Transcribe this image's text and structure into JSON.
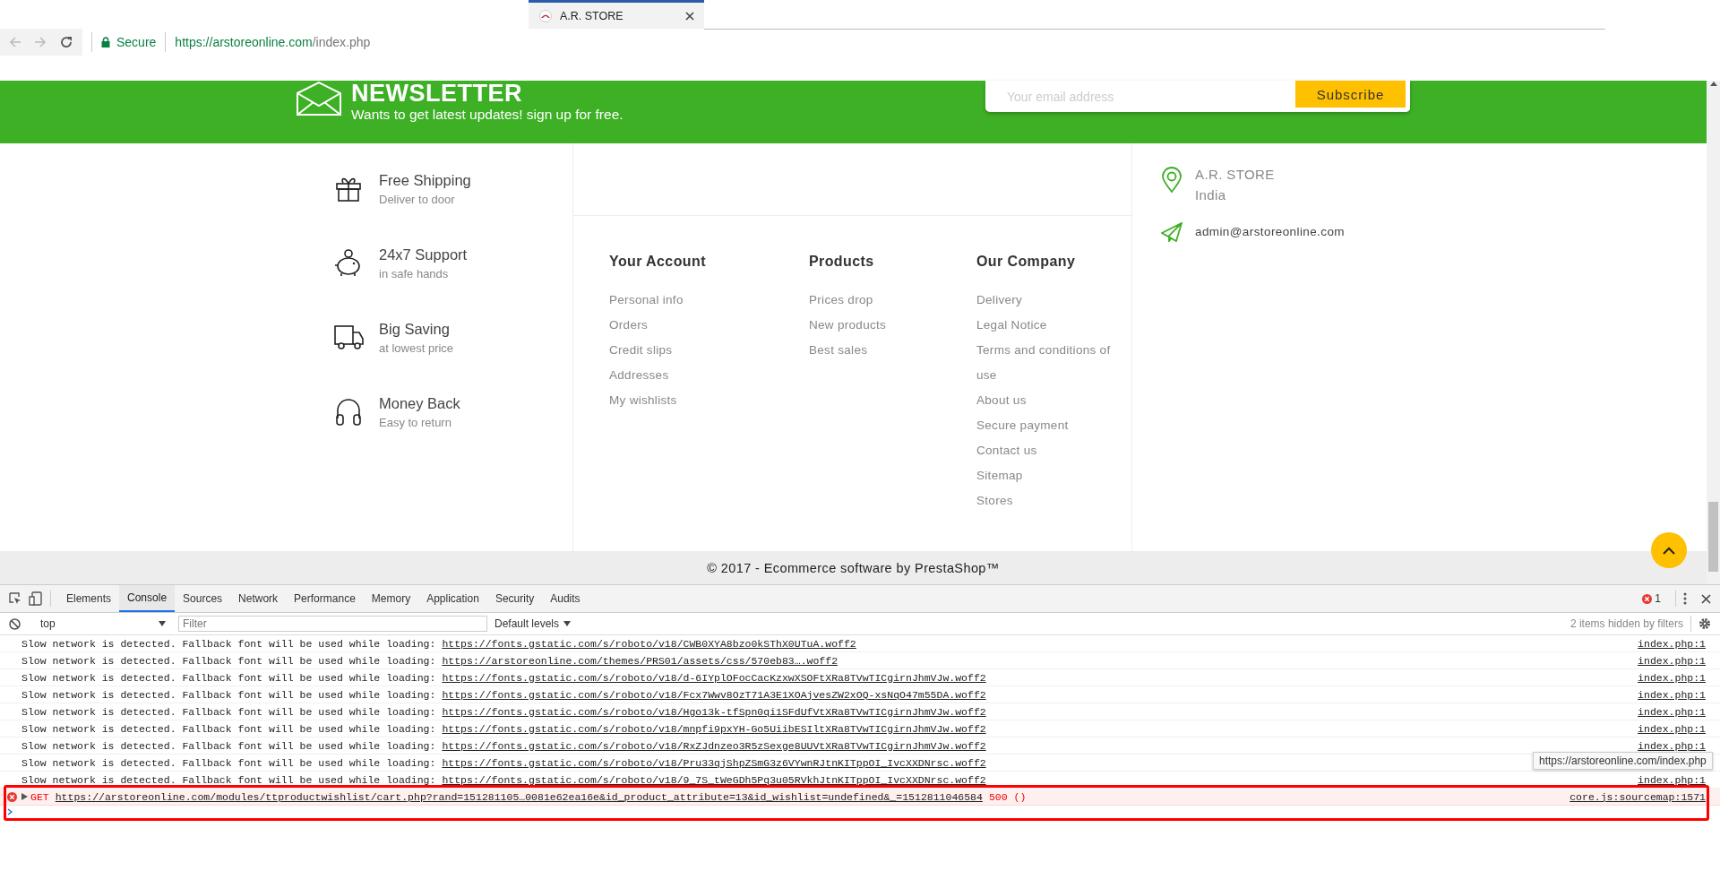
{
  "browser": {
    "tab": {
      "title": "A.R. STORE"
    },
    "security": "Secure",
    "url_host": "https://arstoreonline.com",
    "url_path": "/index.php"
  },
  "newsletter": {
    "title": "NEWSLETTER",
    "subtitle": "Wants to get latest updates! sign up for free.",
    "email": {
      "placeholder": "Your email address"
    },
    "button": "Subscribe"
  },
  "features": [
    {
      "kind": "gift",
      "title": "Free Shipping",
      "subtitle": "Deliver to door"
    },
    {
      "kind": "piggy",
      "title": "24x7 Support",
      "subtitle": "in safe hands"
    },
    {
      "kind": "truck",
      "title": "Big Saving",
      "subtitle": "at lowest price"
    },
    {
      "kind": "headphones",
      "title": "Money Back",
      "subtitle": "Easy to return"
    }
  ],
  "link_columns": [
    {
      "heading": "Your Account",
      "links": [
        "Personal info",
        "Orders",
        "Credit slips",
        "Addresses",
        "My wishlists"
      ]
    },
    {
      "heading": "Products",
      "links": [
        "Prices drop",
        "New products",
        "Best sales"
      ]
    },
    {
      "heading": "Our Company",
      "links": [
        "Delivery",
        "Legal Notice",
        "Terms and conditions of use",
        "About us",
        "Secure payment",
        "Contact us",
        "Sitemap",
        "Stores"
      ]
    }
  ],
  "store_info": {
    "name": "A.R. STORE",
    "country": "India",
    "email": "admin@arstoreonline.com"
  },
  "copyright": "© 2017 - Ecommerce software by PrestaShop™",
  "devtools": {
    "tabs": [
      {
        "label": "Elements",
        "selected": false
      },
      {
        "label": "Console",
        "selected": true
      },
      {
        "label": "Sources",
        "selected": false
      },
      {
        "label": "Network",
        "selected": false
      },
      {
        "label": "Performance",
        "selected": false
      },
      {
        "label": "Memory",
        "selected": false
      },
      {
        "label": "Application",
        "selected": false
      },
      {
        "label": "Security",
        "selected": false
      },
      {
        "label": "Audits",
        "selected": false
      }
    ],
    "error_count": "1",
    "context": "top",
    "filter": {
      "placeholder": "Filter"
    },
    "levels": "Default levels",
    "hidden_note": "2 items hidden by filters",
    "messages": [
      {
        "kind": "warning",
        "text": "Slow network is detected. Fallback font will be used while loading:",
        "url": "https://fonts.gstatic.com/s/roboto/v18/CWB0XYA8bzo0kSThX0UTuA.woff2",
        "source": "index.php:1"
      },
      {
        "kind": "warning",
        "text": "Slow network is detected. Fallback font will be used while loading:",
        "url": "https://arstoreonline.com/themes/PRS01/assets/css/570eb83….woff2",
        "source": "index.php:1"
      },
      {
        "kind": "warning",
        "text": "Slow network is detected. Fallback font will be used while loading:",
        "url": "https://fonts.gstatic.com/s/roboto/v18/d-6IYplOFocCacKzxwXSOFtXRa8TVwTICgirnJhmVJw.woff2",
        "source": "index.php:1"
      },
      {
        "kind": "warning",
        "text": "Slow network is detected. Fallback font will be used while loading:",
        "url": "https://fonts.gstatic.com/s/roboto/v18/Fcx7Wwv8OzT71A3E1XOAjvesZW2xOQ-xsNqO47m55DA.woff2",
        "source": "index.php:1"
      },
      {
        "kind": "warning",
        "text": "Slow network is detected. Fallback font will be used while loading:",
        "url": "https://fonts.gstatic.com/s/roboto/v18/Hgo13k-tfSpn0qi1SFdUfVtXRa8TVwTICgirnJhmVJw.woff2",
        "source": "index.php:1"
      },
      {
        "kind": "warning",
        "text": "Slow network is detected. Fallback font will be used while loading:",
        "url": "https://fonts.gstatic.com/s/roboto/v18/mnpfi9pxYH-Go5UiibESIltXRa8TVwTICgirnJhmVJw.woff2",
        "source": "index.php:1"
      },
      {
        "kind": "warning",
        "text": "Slow network is detected. Fallback font will be used while loading:",
        "url": "https://fonts.gstatic.com/s/roboto/v18/RxZJdnzeo3R5zSexge8UUVtXRa8TVwTICgirnJhmVJw.woff2",
        "source": "index.php:1"
      },
      {
        "kind": "warning",
        "text": "Slow network is detected. Fallback font will be used while loading:",
        "url": "https://fonts.gstatic.com/s/roboto/v18/Pru33qjShpZSmG3z6VYwnRJtnKITppOI_IvcXXDNrsc.woff2"
      },
      {
        "kind": "warning",
        "text": "Slow network is detected. Fallback font will be used while loading:",
        "url": "https://fonts.gstatic.com/s/roboto/v18/9_7S_tWeGDh5Pq3u05RVkhJtnKITppOI_IvcXXDNrsc.woff2",
        "source": "index.php:1"
      },
      {
        "kind": "error",
        "method": "GET",
        "url": "https://arstoreonline.com/modules/ttproductwishlist/cart.php?rand=151281105…0081e62ea16e&id_product_attribute=13&id_wishlist=undefined&_=1512811046584",
        "status": "500 ()",
        "source": "core.js:sourcemap:1571"
      }
    ],
    "tooltip": "https://arstoreonline.com/index.php"
  }
}
